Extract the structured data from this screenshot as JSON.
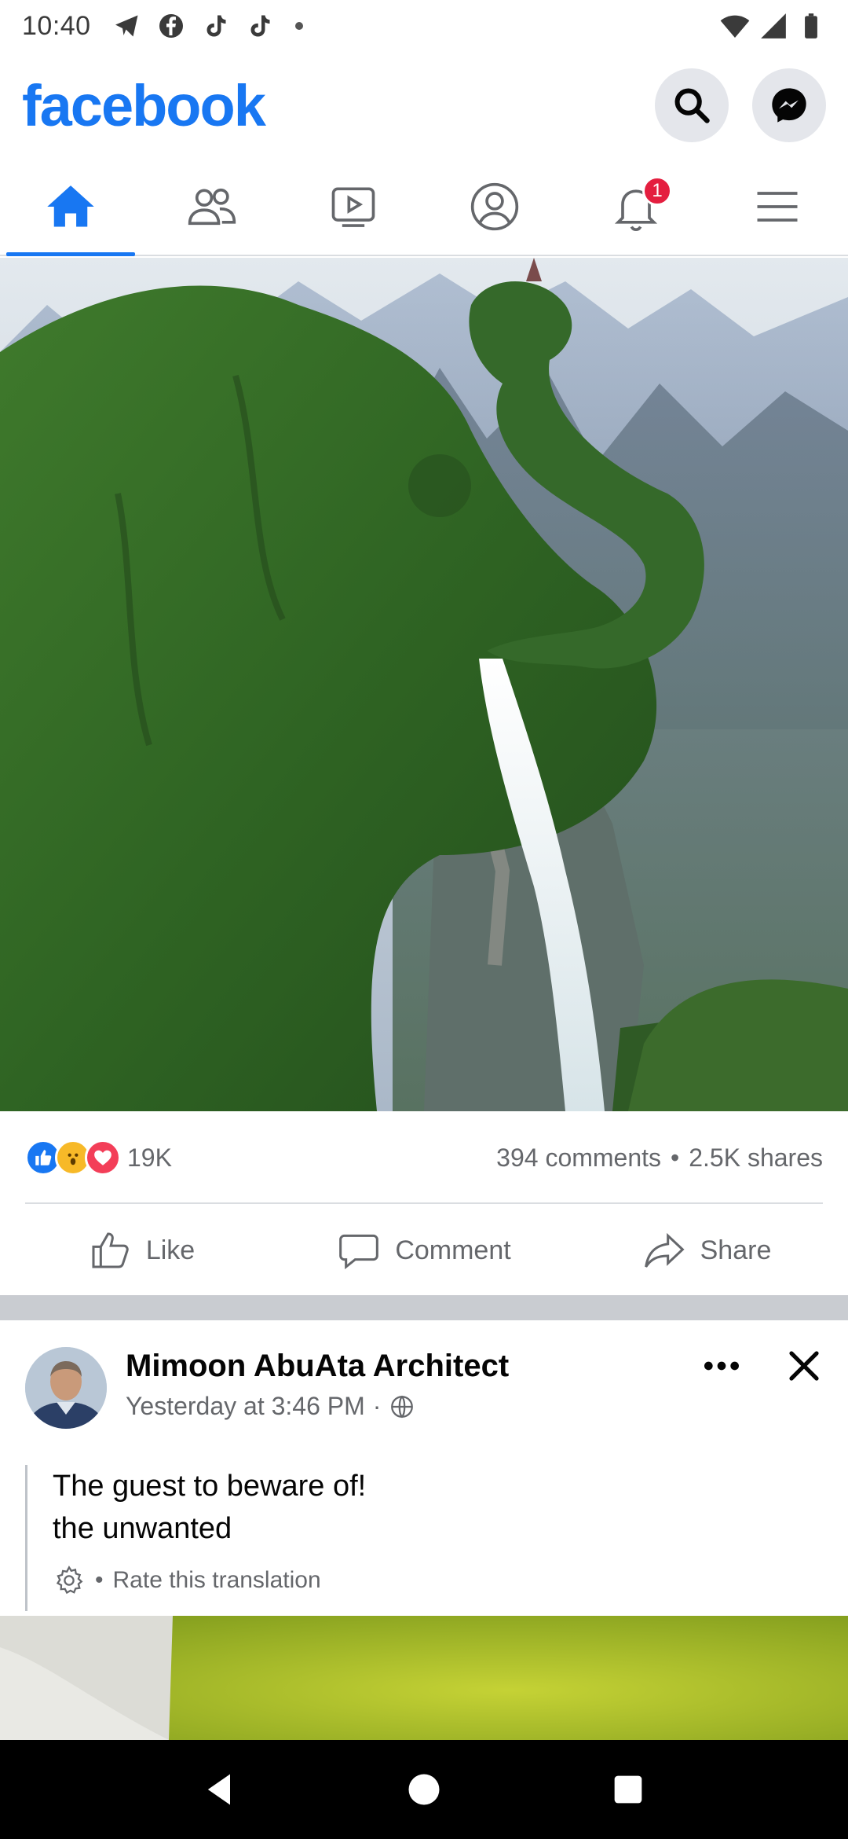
{
  "status_bar": {
    "time": "10:40",
    "left_icons": [
      "telegram-icon",
      "facebook-icon",
      "tiktok-icon",
      "tiktok-icon",
      "dot-icon"
    ],
    "right_icons": [
      "wifi-icon",
      "signal-icon",
      "battery-icon"
    ]
  },
  "header": {
    "logo": "facebook",
    "brand_color": "#1877f2"
  },
  "tabs": [
    {
      "name": "home",
      "icon": "home-icon",
      "active": true
    },
    {
      "name": "friends",
      "icon": "friends-icon",
      "active": false
    },
    {
      "name": "watch",
      "icon": "video-icon",
      "active": false
    },
    {
      "name": "profile",
      "icon": "profile-icon",
      "active": false
    },
    {
      "name": "notifications",
      "icon": "bell-icon",
      "active": false,
      "badge": "1"
    },
    {
      "name": "menu",
      "icon": "menu-icon",
      "active": false
    }
  ],
  "post1": {
    "reactions": [
      "like",
      "wow",
      "love"
    ],
    "reaction_count": "19K",
    "comments": "394 comments",
    "shares": "2.5K shares",
    "actions": {
      "like": "Like",
      "comment": "Comment",
      "share": "Share"
    }
  },
  "post2": {
    "author": "Mimoon AbuAta Architect",
    "time": "Yesterday at 3:46 PM",
    "meta_separator": "·",
    "privacy_icon": "globe-icon",
    "text_lines": [
      "The guest to beware of!",
      "the unwanted"
    ],
    "translation_bullet": "•",
    "translation_label": "Rate this translation"
  }
}
